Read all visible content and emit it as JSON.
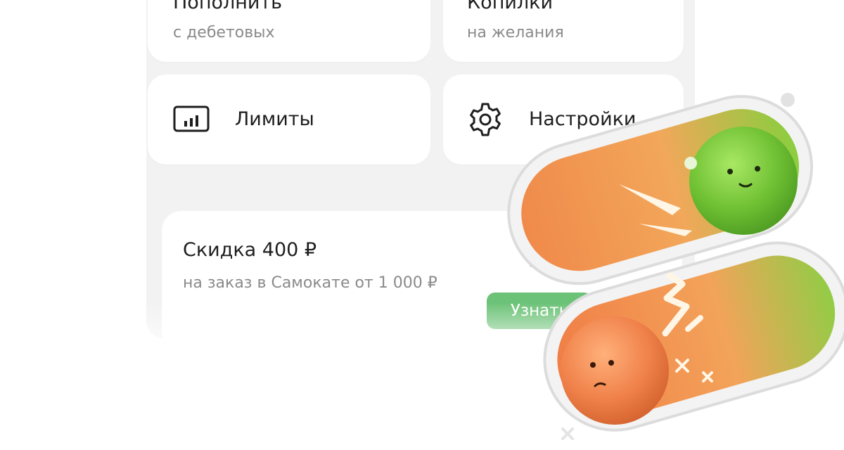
{
  "cards": {
    "topup": {
      "title": "Пополнить",
      "subtitle": "с дебетовых"
    },
    "savings": {
      "title": "Копилки",
      "subtitle": "на желания"
    },
    "limits": {
      "title": "Лимиты",
      "icon": "bar-chart-icon"
    },
    "settings": {
      "title": "Настройки",
      "icon": "gear-icon"
    }
  },
  "promo": {
    "title": "Скидка 400 ₽",
    "subtitle": "на заказ в Самокате от 1 000 ₽",
    "button_label": "Узнать",
    "icon": "bag-icon"
  },
  "illustration": {
    "name": "toggle-switches-illustration",
    "colors": {
      "green": "#7fcf3a",
      "orange": "#f08a4b"
    }
  }
}
